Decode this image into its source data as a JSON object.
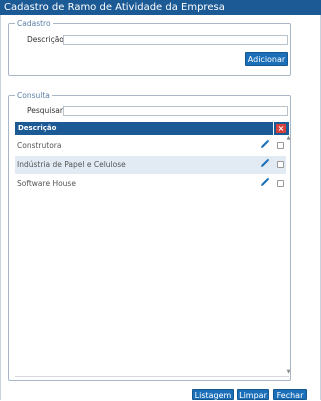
{
  "window": {
    "title": "Cadastro de Ramo de Atividade da Empresa"
  },
  "cadastro": {
    "legend": "Cadastro",
    "descricao_label": "Descrição:",
    "descricao_value": "",
    "add_button": "Adicionar"
  },
  "consulta": {
    "legend": "Consulta",
    "pesquisar_label": "Pesquisar:",
    "pesquisar_value": "",
    "grid": {
      "header": "Descrição",
      "rows": [
        {
          "descricao": "Construtora",
          "checked": false
        },
        {
          "descricao": "Indústria de Papel e Celulose",
          "checked": false
        },
        {
          "descricao": "Software House",
          "checked": false
        }
      ]
    }
  },
  "footer": {
    "listagem": "Listagem",
    "limpar": "Limpar",
    "fechar": "Fechar"
  },
  "colors": {
    "header_blue": "#1c5a96",
    "button_blue": "#1b6fb8",
    "row_alt": "#e2ebf4",
    "delete_red": "#d9413b"
  },
  "icons": {
    "edit": "pencil-icon",
    "delete_all": "close-icon"
  }
}
